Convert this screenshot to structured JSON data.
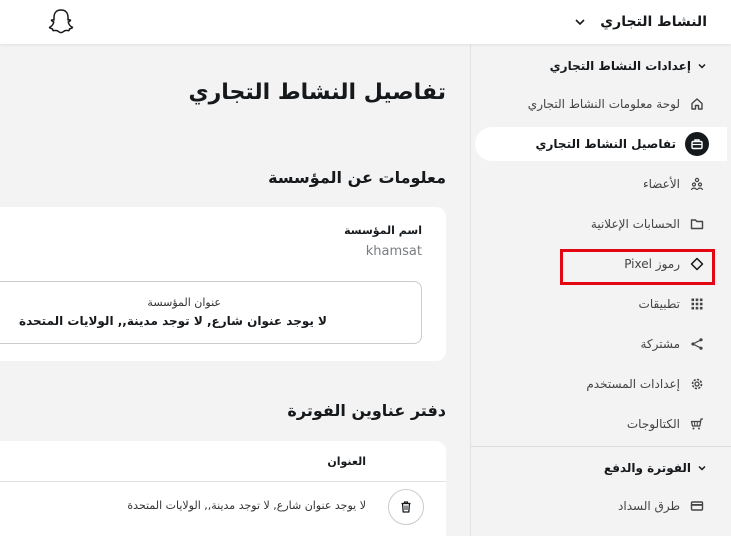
{
  "header": {
    "business_name": "النشاط التجاري",
    "logo_icon": "snapchat-ghost-icon",
    "chevron_icon": "chevron-down-icon"
  },
  "sidebar": {
    "section_business": "إعدادات النشاط التجاري",
    "items": [
      {
        "label": "لوحة معلومات النشاط التجاري",
        "icon": "home-icon"
      },
      {
        "label": "تفاصيل النشاط التجاري",
        "icon": "briefcase-icon",
        "active": true
      },
      {
        "label": "الأعضاء",
        "icon": "members-icon"
      },
      {
        "label": "الحسابات الإعلانية",
        "icon": "folder-icon"
      },
      {
        "label": "رموز Pixel",
        "icon": "diamond-icon",
        "highlighted": true
      },
      {
        "label": "تطبيقات",
        "icon": "grid-icon"
      },
      {
        "label": "مشتركة",
        "icon": "share-icon"
      },
      {
        "label": "إعدادات المستخدم",
        "icon": "gear-icon"
      },
      {
        "label": "الكتالوجات",
        "icon": "cart-icon"
      }
    ],
    "section_billing": "الفوترة والدفع",
    "billing_items": [
      {
        "label": "طرق السداد",
        "icon": "credit-card-icon"
      }
    ],
    "highlight_color": "#e30613"
  },
  "main": {
    "page_title": "تفاصيل النشاط التجاري",
    "org_section_title": "معلومات عن المؤسسة",
    "org_name_label": "اسم المؤسسة",
    "org_name_value": "khamsat",
    "org_address_label": "عنوان المؤسسة",
    "org_address_value": "لا يوجد عنوان شارع, لا توجد مدينة,, الولايات المتحدة",
    "billing_section_title": "دفتر عناوين الفوترة",
    "billing_table": {
      "columns": [
        "العنوان"
      ],
      "rows": [
        {
          "address": "لا يوجد عنوان شارع, لا توجد مدينة,, الولايات المتحدة",
          "action_icon": "trash-icon"
        }
      ]
    }
  }
}
